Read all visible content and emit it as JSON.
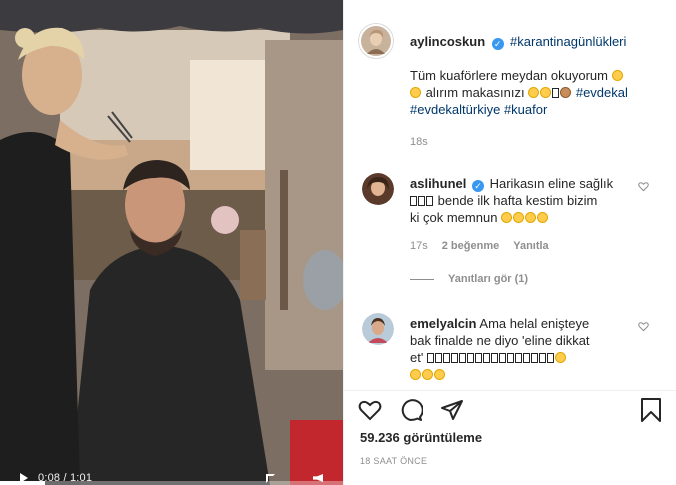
{
  "video": {
    "time": "0:08 / 1:01"
  },
  "post": {
    "username": "aylincoskun",
    "header_hashtag": "#karantinagünlükleri",
    "caption_line1": "Tüm kuaförlere meydan okuyorum",
    "caption_line2": "alırım makasınızı",
    "caption_tags_1": "#evdekal",
    "caption_tags_2": "#evdekaltürkiye",
    "caption_tags_3": "#kuafor",
    "caption_time": "18s"
  },
  "comments": [
    {
      "username": "aslihunel",
      "text_line1": "Harikasın eline sağlık",
      "text_line2": "bende ilk hafta kestim bizim",
      "text_line3": "ki çok memnun",
      "time": "17s",
      "likes": "2 beğenme",
      "reply": "Yanıtla"
    },
    {
      "username": "emelyalcin",
      "text_line1": "Ama helal enişteye",
      "text_line2": "bak finalde ne diyo 'eline dikkat",
      "text_line3": "et'"
    }
  ],
  "replies_label": "Yanıtları gör (1)",
  "stats": {
    "views": "59.236 görüntüleme",
    "ago": "18 SAAT ÖNCE"
  },
  "icons": {
    "like": "heart-icon",
    "comment": "comment-icon",
    "share": "share-icon",
    "save": "bookmark-icon"
  },
  "colors": {
    "link": "#00376b",
    "verified": "#3897f0",
    "muted": "#8e8e8e"
  }
}
